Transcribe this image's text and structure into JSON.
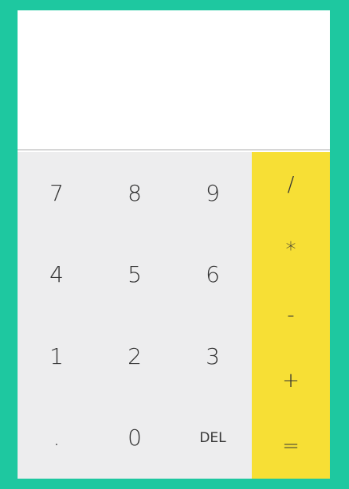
{
  "colors": {
    "background": "#1ec8a0",
    "display": "#ffffff",
    "keypad": "#ededee",
    "operators": "#f7df35",
    "text": "#333333"
  },
  "display": {
    "expression": "",
    "result": ""
  },
  "keypad": {
    "rows": [
      [
        "7",
        "8",
        "9"
      ],
      [
        "4",
        "5",
        "6"
      ],
      [
        "1",
        "2",
        "3"
      ],
      [
        ".",
        "0",
        "DEL"
      ]
    ]
  },
  "operators": [
    "/",
    "*",
    "-",
    "+",
    "="
  ]
}
